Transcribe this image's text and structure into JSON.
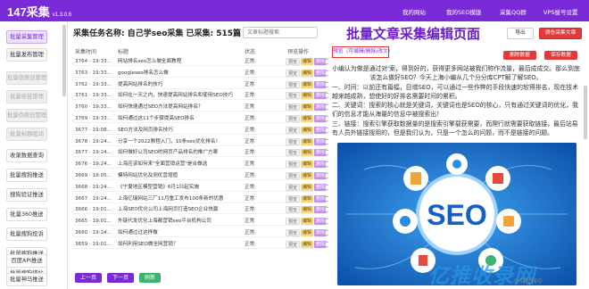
{
  "app": {
    "logo": "147采集",
    "version": "v1.3.0.6",
    "nav": [
      "我的网站",
      "我的SEO模版",
      "采集QQ群",
      "VPS拔号设置"
    ]
  },
  "sidebar": {
    "items": [
      {
        "label": "批量采集管理",
        "state": "active"
      },
      {
        "label": "批量发布管理",
        "state": "mid"
      },
      {
        "label": "批量伪原创管理",
        "state": "dim"
      },
      {
        "label": "批量挂链管理",
        "state": "dim"
      },
      {
        "label": "批量伪原创管理",
        "state": "dim"
      },
      {
        "label": "批量标题组词",
        "state": "dim"
      },
      {
        "label": "收录数据查询",
        "state": "normal"
      },
      {
        "label": "批量搜狗推送",
        "state": "normal"
      },
      {
        "label": "搜狗验证推送",
        "state": "normal"
      },
      {
        "label": "批量360推送",
        "state": "normal"
      },
      {
        "label": "批量搜狗投诉",
        "state": "normal"
      },
      {
        "label": "批量搜狗推送",
        "state": "normal"
      },
      {
        "label": "批量搜狗绑站",
        "state": "normal"
      },
      {
        "label": "百度API推送",
        "state": "normal"
      },
      {
        "label": "批量神马推送",
        "state": "normal"
      }
    ]
  },
  "header": {
    "title": "采集任务名称: 自己学seo采集 已采集: 515篇",
    "search_placeholder": "文章标题搜索"
  },
  "big_title": "批量文章采集编辑页面",
  "toolbar": {
    "export": "导出",
    "publish": "调仓采集文章"
  },
  "table": {
    "columns": [
      "采集时间",
      "标题",
      "状态",
      "预览操作",
      "操作"
    ],
    "ops": [
      "预览",
      "编辑",
      "删除"
    ],
    "rows": [
      {
        "time": "3764 · 19:33...",
        "title": "网站排名seo怎么做全面教程",
        "status": "正常"
      },
      {
        "time": "3763 · 19:33...",
        "title": "googleseo排名怎么做",
        "status": "正常"
      },
      {
        "time": "3762 · 19:33...",
        "title": "提高网站排名的技巧",
        "status": "正常"
      },
      {
        "time": "3761 · 19:33...",
        "title": "如何在一天之内，快速提高网站排名和使用SEO技巧",
        "status": "正常"
      },
      {
        "time": "3760 · 19:33...",
        "title": "如何快速通过SEO方法提高网站排名？",
        "status": "正常"
      },
      {
        "time": "3769 · 19:33...",
        "title": "如何通过这11个步骤提高SEO排名",
        "status": "正常"
      },
      {
        "time": "3677 · 19:08...",
        "title": "SEO方法及网页排名技巧",
        "status": "正常"
      },
      {
        "time": "3678 · 19:24...",
        "title": "分享一个2022教程入门，10条seo优化排名！",
        "status": "正常"
      },
      {
        "time": "3677 · 19:24...",
        "title": "如何做好公司SEO的网页产品排名的推广方案",
        "status": "正常"
      },
      {
        "time": "3676 · 19:24...",
        "title": "上海应该如何来\"全面营销运营\"是合做选",
        "status": "正常"
      },
      {
        "time": "3669 · 18:05...",
        "title": "模特网站优化及测优营增值",
        "status": "正常"
      },
      {
        "time": "3668 · 19:24...",
        "title": "《宁夏地区模型营销》6月1日起实施",
        "status": "正常"
      },
      {
        "time": "3667 · 19:24...",
        "title": "上海亿瑞网站三厂11月重工发布100条新的优惠",
        "status": "正常"
      },
      {
        "time": "3666 · 19:01...",
        "title": "上海SEO优化公司上海网页打造SEO企业快赢",
        "status": "正常"
      },
      {
        "time": "3665 · 19:01...",
        "title": "外链代发优化上海都营销seo平台机构公司",
        "status": "正常"
      },
      {
        "time": "3660 · 19:24...",
        "title": "如何通过过这样做",
        "status": "正常"
      },
      {
        "time": "3659 · 19:01...",
        "title": "如何利用SEO做全网营销？",
        "status": "正常"
      }
    ]
  },
  "pager": {
    "prev": "上一页",
    "next": "下一页",
    "refresh": "刷新"
  },
  "detail": {
    "tag": "预览（可编辑/删除/改文）",
    "delete": "删除数据",
    "save": "保存数据",
    "paragraphs": [
      "小编认为做是通过对'案，得到好的，获得更多网站被我们称作流量，最后成成交。那么到底该怎么做好SEO？今天上海小编从几个分分库CPT解了解SEO。",
      "一、时间：以前还有篇幅，目增SEO，可以通过一些作弊的手段快速的软得排名，现在技术越来越成熟，想使好的好排名需要时间的累积。",
      "二、关键词：搜索的核心就是关键词，关键词也是SEO的核心，只有通过关键词的优化，我们的信息才能从海量的信息中被搜索出！",
      "三、链接：搜索引擎获取数据量的是搜索引擎载获需要，而爬行就需要获取链接，最后站易有人员外链接搜用的，但是我们认为，只是一个怎么的问题，而不是链接的问题。"
    ],
    "image_text": "SEO"
  },
  "watermark": "亿推收录网",
  "watermark_small": "@ 白起SEO"
}
